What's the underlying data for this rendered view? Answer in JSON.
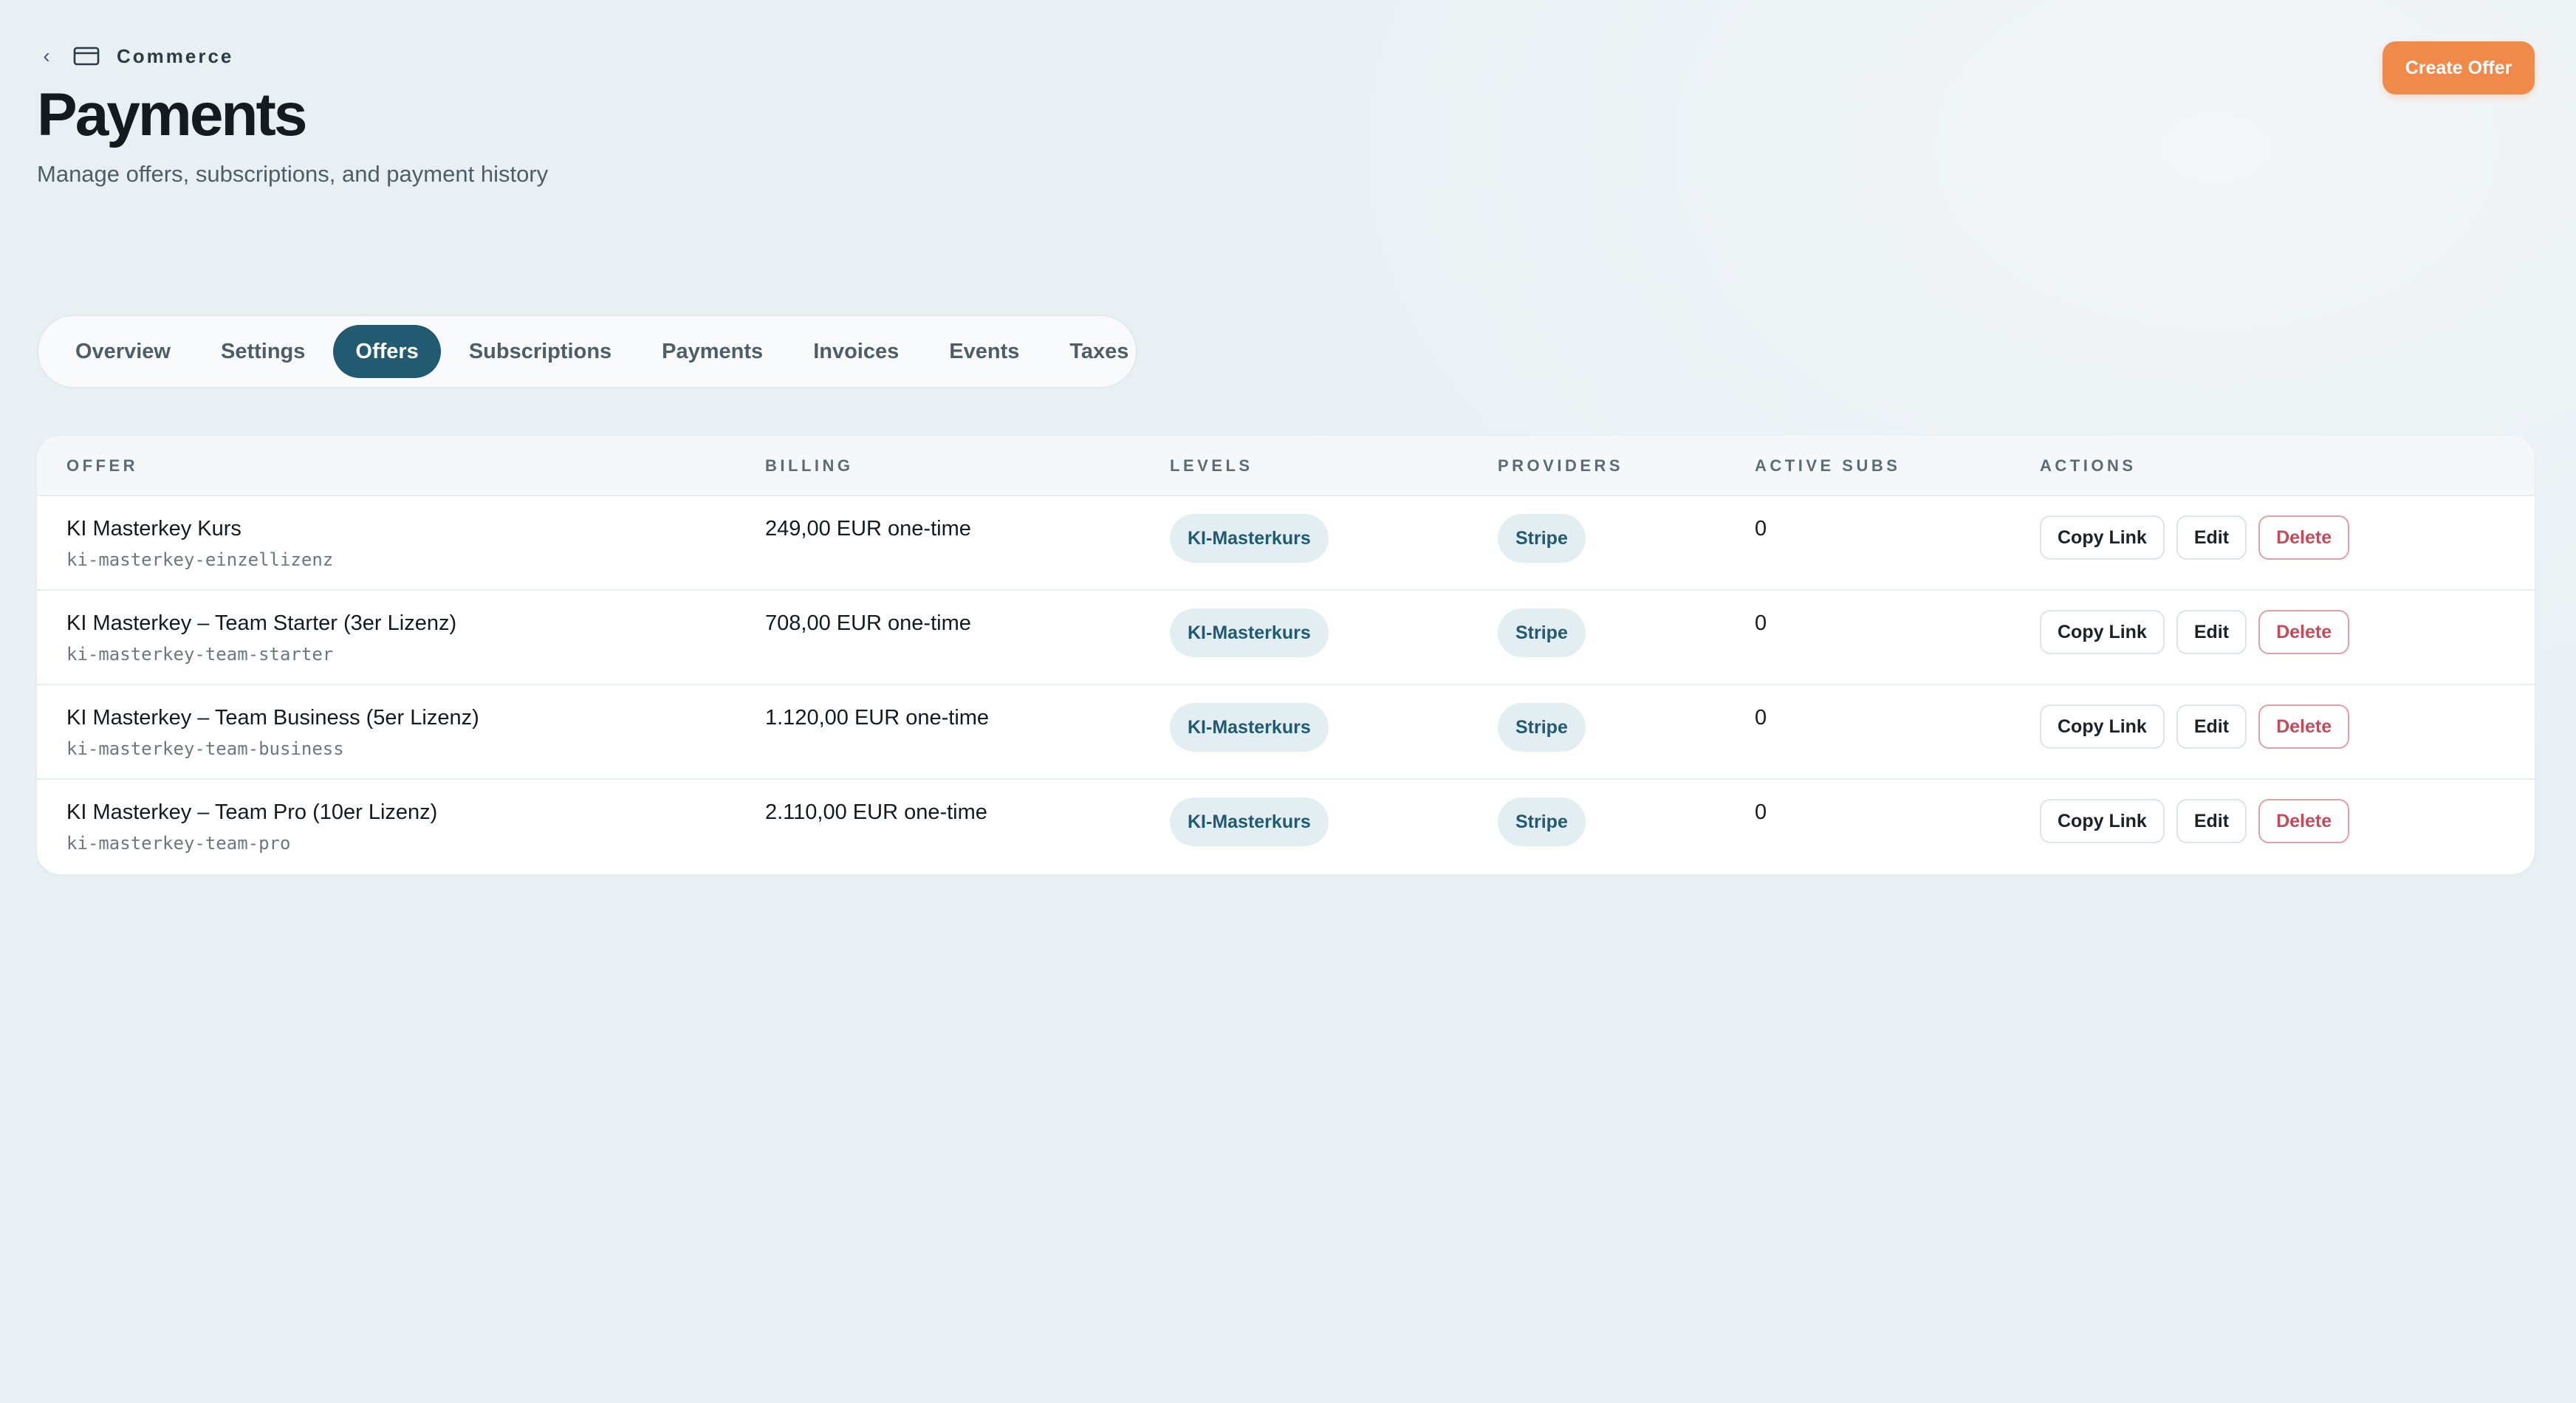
{
  "breadcrumb": {
    "label": "Commerce"
  },
  "header": {
    "title": "Payments",
    "subtitle": "Manage offers, subscriptions, and payment history",
    "create_label": "Create Offer"
  },
  "tabs": [
    {
      "label": "Overview",
      "active": false
    },
    {
      "label": "Settings",
      "active": false
    },
    {
      "label": "Offers",
      "active": true
    },
    {
      "label": "Subscriptions",
      "active": false
    },
    {
      "label": "Payments",
      "active": false
    },
    {
      "label": "Invoices",
      "active": false
    },
    {
      "label": "Events",
      "active": false
    },
    {
      "label": "Taxes",
      "active": false
    }
  ],
  "table": {
    "columns": [
      "OFFER",
      "BILLING",
      "LEVELS",
      "PROVIDERS",
      "ACTIVE SUBS",
      "ACTIONS"
    ],
    "rows": [
      {
        "name": "KI Masterkey Kurs",
        "slug": "ki-masterkey-einzellizenz",
        "billing": "249,00 EUR one-time",
        "level": "KI-Masterkurs",
        "provider": "Stripe",
        "active_subs": "0"
      },
      {
        "name": "KI Masterkey – Team Starter (3er Lizenz)",
        "slug": "ki-masterkey-team-starter",
        "billing": "708,00 EUR one-time",
        "level": "KI-Masterkurs",
        "provider": "Stripe",
        "active_subs": "0"
      },
      {
        "name": "KI Masterkey – Team Business (5er Lizenz)",
        "slug": "ki-masterkey-team-business",
        "billing": "1.120,00 EUR one-time",
        "level": "KI-Masterkurs",
        "provider": "Stripe",
        "active_subs": "0"
      },
      {
        "name": "KI Masterkey – Team Pro (10er Lizenz)",
        "slug": "ki-masterkey-team-pro",
        "billing": "2.110,00 EUR one-time",
        "level": "KI-Masterkurs",
        "provider": "Stripe",
        "active_subs": "0"
      }
    ],
    "action_labels": {
      "copy": "Copy Link",
      "edit": "Edit",
      "delete": "Delete"
    }
  },
  "colors": {
    "accent": "#f08a4b",
    "active_tab": "#225a72",
    "danger": "#c7495a",
    "pill_bg": "#e3eef3"
  }
}
